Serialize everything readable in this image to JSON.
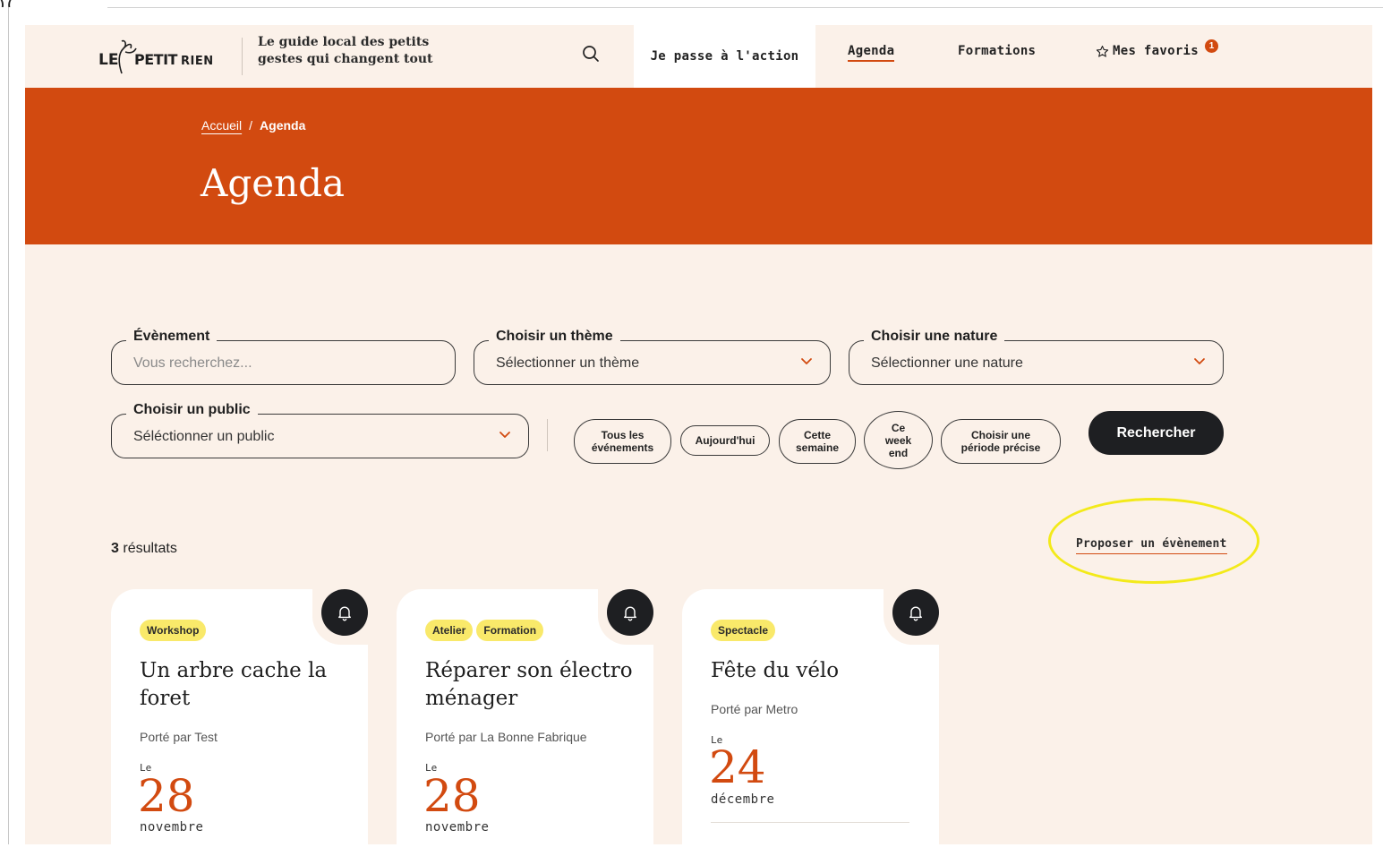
{
  "header": {
    "logo_text": "LE PETIT RIEN",
    "tagline": "Le guide local des petits gestes qui changent tout",
    "nav": {
      "action": "Je passe à l'action",
      "agenda": "Agenda",
      "formations": "Formations",
      "favorites": "Mes favoris",
      "favorites_count": "1"
    }
  },
  "hero": {
    "breadcrumb": {
      "home": "Accueil",
      "separator": "/",
      "current": "Agenda"
    },
    "title": "Agenda"
  },
  "filters": {
    "event": {
      "label": "Évènement",
      "placeholder": "Vous recherchez..."
    },
    "theme": {
      "label": "Choisir un thème",
      "value": "Sélectionner un thème"
    },
    "nature": {
      "label": "Choisir une nature",
      "value": "Sélectionner une nature"
    },
    "public": {
      "label": "Choisir un public",
      "value": "Séléctionner un public"
    },
    "periods": {
      "all": "Tous les événements",
      "today": "Aujourd'hui",
      "week": "Cette semaine",
      "weekend": "Ce week end",
      "custom": "Choisir une période précise"
    },
    "search_button": "Rechercher"
  },
  "results": {
    "count": "3",
    "label": "résultats",
    "propose_link": "Proposer un évènement"
  },
  "cards": [
    {
      "tags": [
        "Workshop"
      ],
      "title": "Un arbre cache la foret",
      "by": "Porté par Test",
      "le": "Le",
      "day": "28",
      "month": "novembre"
    },
    {
      "tags": [
        "Atelier",
        "Formation"
      ],
      "title": "Réparer son électro ménager",
      "by": "Porté par La Bonne Fabrique",
      "le": "Le",
      "day": "28",
      "month": "novembre"
    },
    {
      "tags": [
        "Spectacle"
      ],
      "title": "Fête du vélo",
      "by": "Porté par Metro",
      "le": "Le",
      "day": "24",
      "month": "décembre"
    }
  ],
  "colors": {
    "accent": "#d24a10",
    "background": "#fbf1e9",
    "tag": "#f9e96a",
    "dark": "#1e1f22",
    "highlight": "#f3ea1a"
  },
  "icons": {
    "search": "search-icon",
    "chevron": "chevron-down-icon",
    "star": "star-icon",
    "bell": "bell-icon"
  }
}
